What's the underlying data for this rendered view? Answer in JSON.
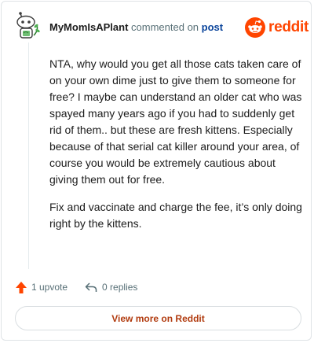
{
  "header": {
    "author": "MyMomIsAPlant",
    "commented_on": "commented on",
    "post_link": "post",
    "brand": "reddit"
  },
  "comment": {
    "paragraphs": [
      "NTA, why would you get all those cats taken care of on your own dime just to give them to someone for free? I maybe can understand an older cat who was spayed many years ago if you had to suddenly get rid of them.. but these are fresh kittens. Especially because of that serial cat killer around your area, of course you would be extremely cautious about giving them out for free.",
      "Fix and vaccinate and charge the fee, it’s only doing right by the kittens."
    ]
  },
  "actions": {
    "upvotes": "1 upvote",
    "replies": "0 replies"
  },
  "footer": {
    "view_more": "View more on Reddit"
  },
  "colors": {
    "brand_orange": "#ff4500",
    "link_blue": "#0a449b",
    "muted_text": "#576f76"
  },
  "icons": [
    "avatar",
    "reddit-logo-icon",
    "upvote-icon",
    "reply-icon"
  ]
}
